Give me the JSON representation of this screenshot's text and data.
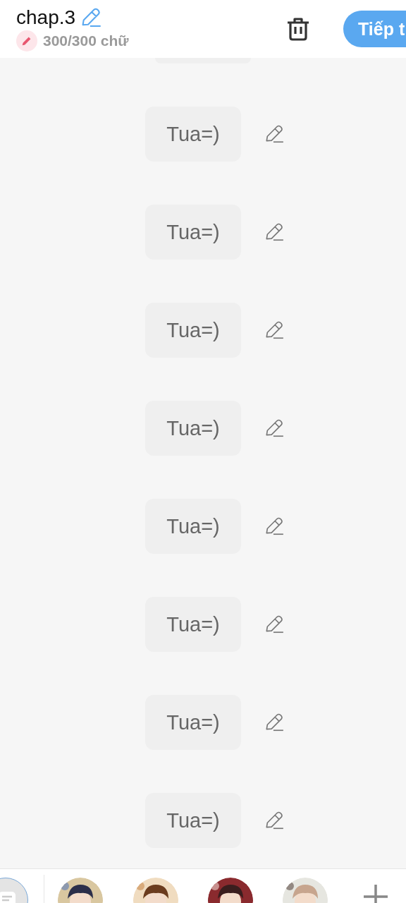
{
  "header": {
    "title": "chap.3",
    "counter": "300/300 chữ",
    "next_button": "Tiếp t"
  },
  "messages": [
    {
      "text": "Tua=)"
    },
    {
      "text": "Tua=)"
    },
    {
      "text": "Tua=)"
    },
    {
      "text": "Tua=)"
    },
    {
      "text": "Tua=)"
    },
    {
      "text": "Tua=)"
    },
    {
      "text": "Tua=)"
    },
    {
      "text": "Tua=)"
    }
  ]
}
